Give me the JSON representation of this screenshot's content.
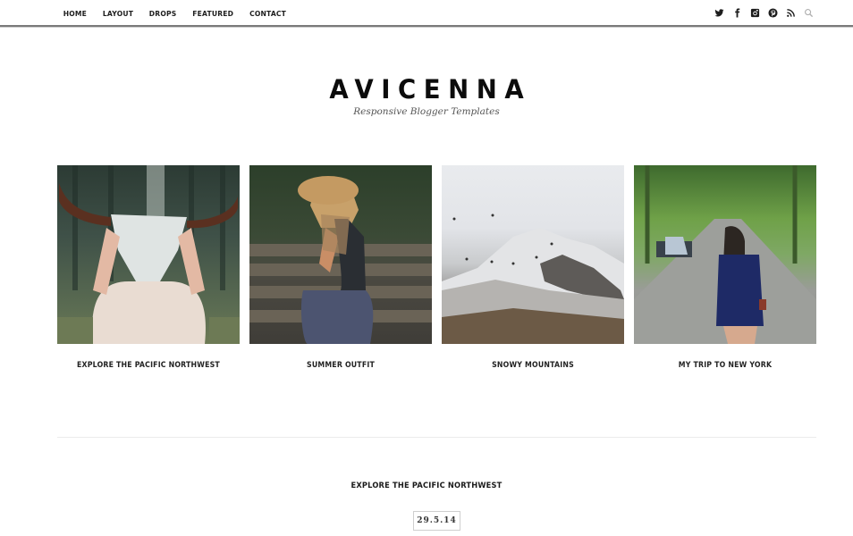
{
  "nav": {
    "items": [
      "HOME",
      "LAYOUT",
      "DROPS",
      "FEATURED",
      "CONTACT"
    ]
  },
  "social": {
    "icons": [
      "twitter-icon",
      "facebook-icon",
      "instagram-icon",
      "pinterest-icon",
      "rss-icon",
      "search-icon"
    ]
  },
  "header": {
    "title": "AVICENNA",
    "tagline": "Responsive Blogger Templates"
  },
  "featured": [
    {
      "title": "EXPLORE THE PACIFIC NORTHWEST",
      "image": "woman holding bull skull in forest"
    },
    {
      "title": "SUMMER OUTFIT",
      "image": "woman in straw hat on wooden bench"
    },
    {
      "title": "SNOWY MOUNTAINS",
      "image": "snowy mountain peak with birds in fog"
    },
    {
      "title": "MY TRIP TO NEW YORK",
      "image": "woman in polka dot dress on park path"
    }
  ],
  "post": {
    "title": "EXPLORE THE PACIFIC NORTHWEST",
    "date": "29.5.14"
  },
  "colors": {
    "text": "#1d1d1d",
    "border": "#7a7a7a",
    "search_icon": "#b0b0b0"
  }
}
